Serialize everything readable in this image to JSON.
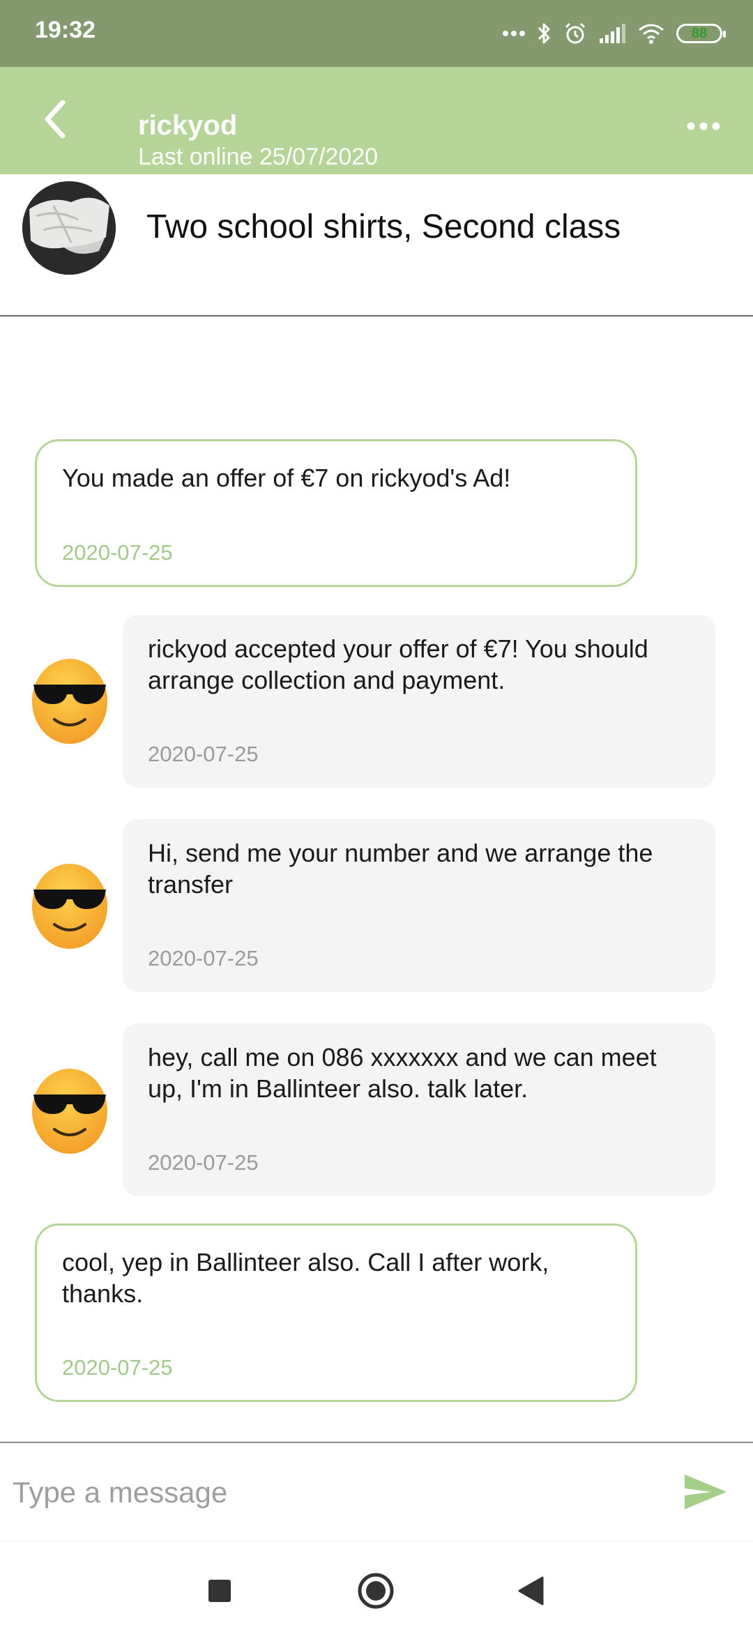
{
  "status_bar": {
    "time": "19:32",
    "battery": "88"
  },
  "header": {
    "contact_name": "rickyod",
    "last_online": "Last online 25/07/2020",
    "back_icon": "chevron-left-icon",
    "more_icon": "more-horizontal-icon"
  },
  "ad": {
    "title": "Two school shirts, Second class"
  },
  "messages": [
    {
      "sender": "me",
      "text": "You made an offer of €7 on rickyod's Ad!",
      "date": "2020-07-25"
    },
    {
      "sender": "rickyod",
      "text": "rickyod accepted your offer of €7! You should arrange collection and payment.",
      "date": "2020-07-25"
    },
    {
      "sender": "rickyod",
      "text": "Hi, send me your number and we arrange the transfer",
      "date": "2020-07-25"
    },
    {
      "sender": "rickyod",
      "text": "hey, call me on 086 xxxxxxx and we can meet up, I'm in Ballinteer also. talk later.",
      "date": "2020-07-25"
    },
    {
      "sender": "me",
      "text": "cool, yep in Ballinteer also. Call I after work, thanks.",
      "date": "2020-07-25"
    }
  ],
  "composer": {
    "placeholder": "Type a message",
    "value": "",
    "send_icon": "send-icon"
  },
  "colors": {
    "status_bar": "#84996e",
    "header": "#b5d598",
    "my_bubble_border": "#b5d598",
    "their_bubble_bg": "#f4f4f4",
    "send_icon": "#a3cf8a"
  }
}
